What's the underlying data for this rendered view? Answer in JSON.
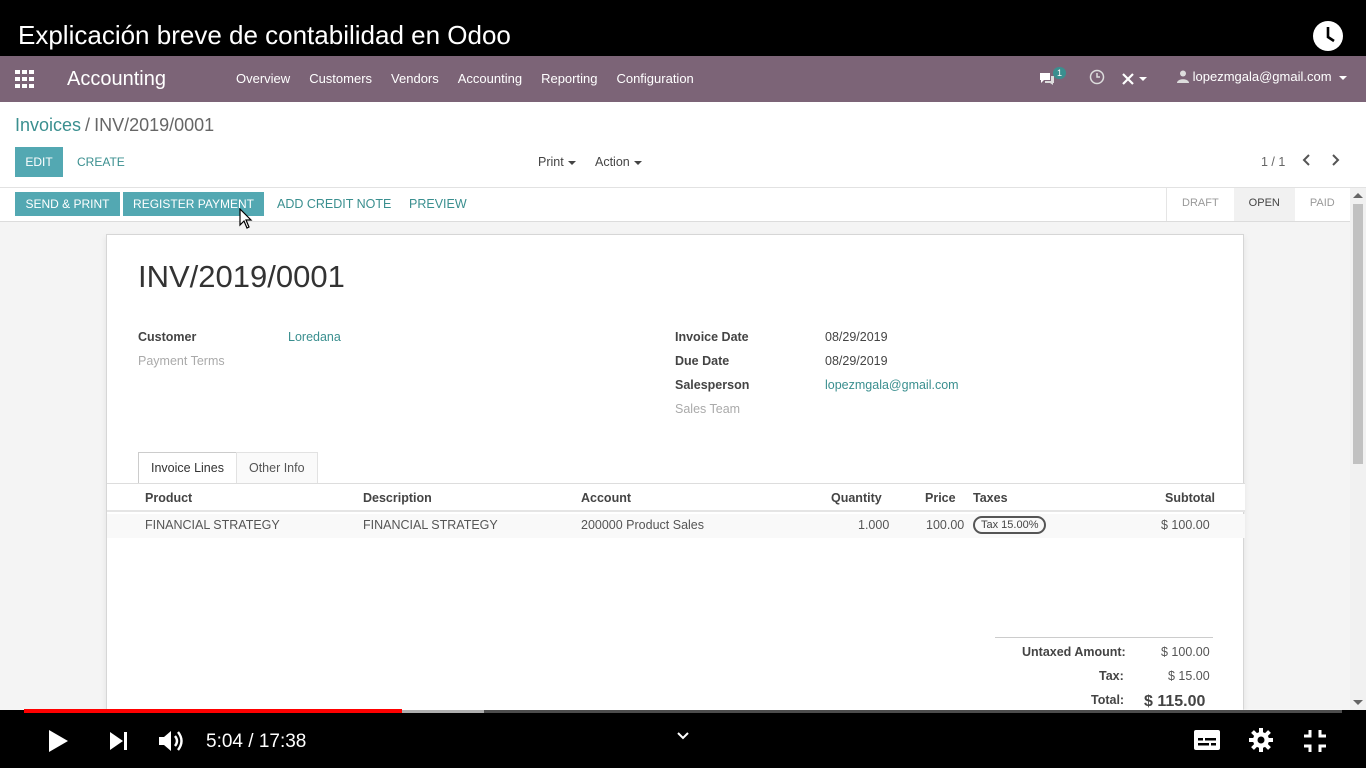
{
  "video": {
    "title": "Explicación breve de contabilidad en Odoo",
    "time_current": "5:04",
    "time_separator": "/",
    "time_total": "17:38",
    "progress_fraction": 0.287
  },
  "navbar": {
    "brand": "Accounting",
    "menu": [
      "Overview",
      "Customers",
      "Vendors",
      "Accounting",
      "Reporting",
      "Configuration"
    ],
    "chat_badge": "1",
    "user": "lopezmgala@gmail.com"
  },
  "control": {
    "breadcrumb_parent": "Invoices",
    "breadcrumb_sep": "/",
    "breadcrumb_current": "INV/2019/0001",
    "edit_label": "EDIT",
    "create_label": "CREATE",
    "print_label": "Print",
    "action_label": "Action",
    "pager": "1 / 1"
  },
  "statusbar": {
    "send_print": "SEND & PRINT",
    "register_payment": "REGISTER PAYMENT",
    "add_credit_note": "ADD CREDIT NOTE",
    "preview": "PREVIEW",
    "states": [
      "DRAFT",
      "OPEN",
      "PAID"
    ],
    "active_state": "OPEN"
  },
  "invoice": {
    "number": "INV/2019/0001",
    "customer_label": "Customer",
    "customer_value": "Loredana",
    "payment_terms_label": "Payment Terms",
    "invoice_date_label": "Invoice Date",
    "invoice_date_value": "08/29/2019",
    "due_date_label": "Due Date",
    "due_date_value": "08/29/2019",
    "salesperson_label": "Salesperson",
    "salesperson_value": "lopezmgala@gmail.com",
    "sales_team_label": "Sales Team"
  },
  "tabs": [
    "Invoice Lines",
    "Other Info"
  ],
  "lines": {
    "columns": [
      "Product",
      "Description",
      "Account",
      "Quantity",
      "Price",
      "Taxes",
      "Subtotal"
    ],
    "rows": [
      {
        "product": "FINANCIAL STRATEGY",
        "description": "FINANCIAL STRATEGY",
        "account": "200000 Product Sales",
        "quantity": "1.000",
        "price": "100.00",
        "taxes": "Tax 15.00%",
        "subtotal": "$ 100.00"
      }
    ]
  },
  "totals": {
    "untaxed_label": "Untaxed Amount:",
    "untaxed_value": "$ 100.00",
    "tax_label": "Tax:",
    "tax_value": "$ 15.00",
    "total_label": "Total:",
    "total_value": "$ 115.00"
  },
  "colors": {
    "navbar": "#7c6477",
    "primary_button": "#53a8b2",
    "link": "#3a8f8f",
    "progress": "#ff0000"
  }
}
